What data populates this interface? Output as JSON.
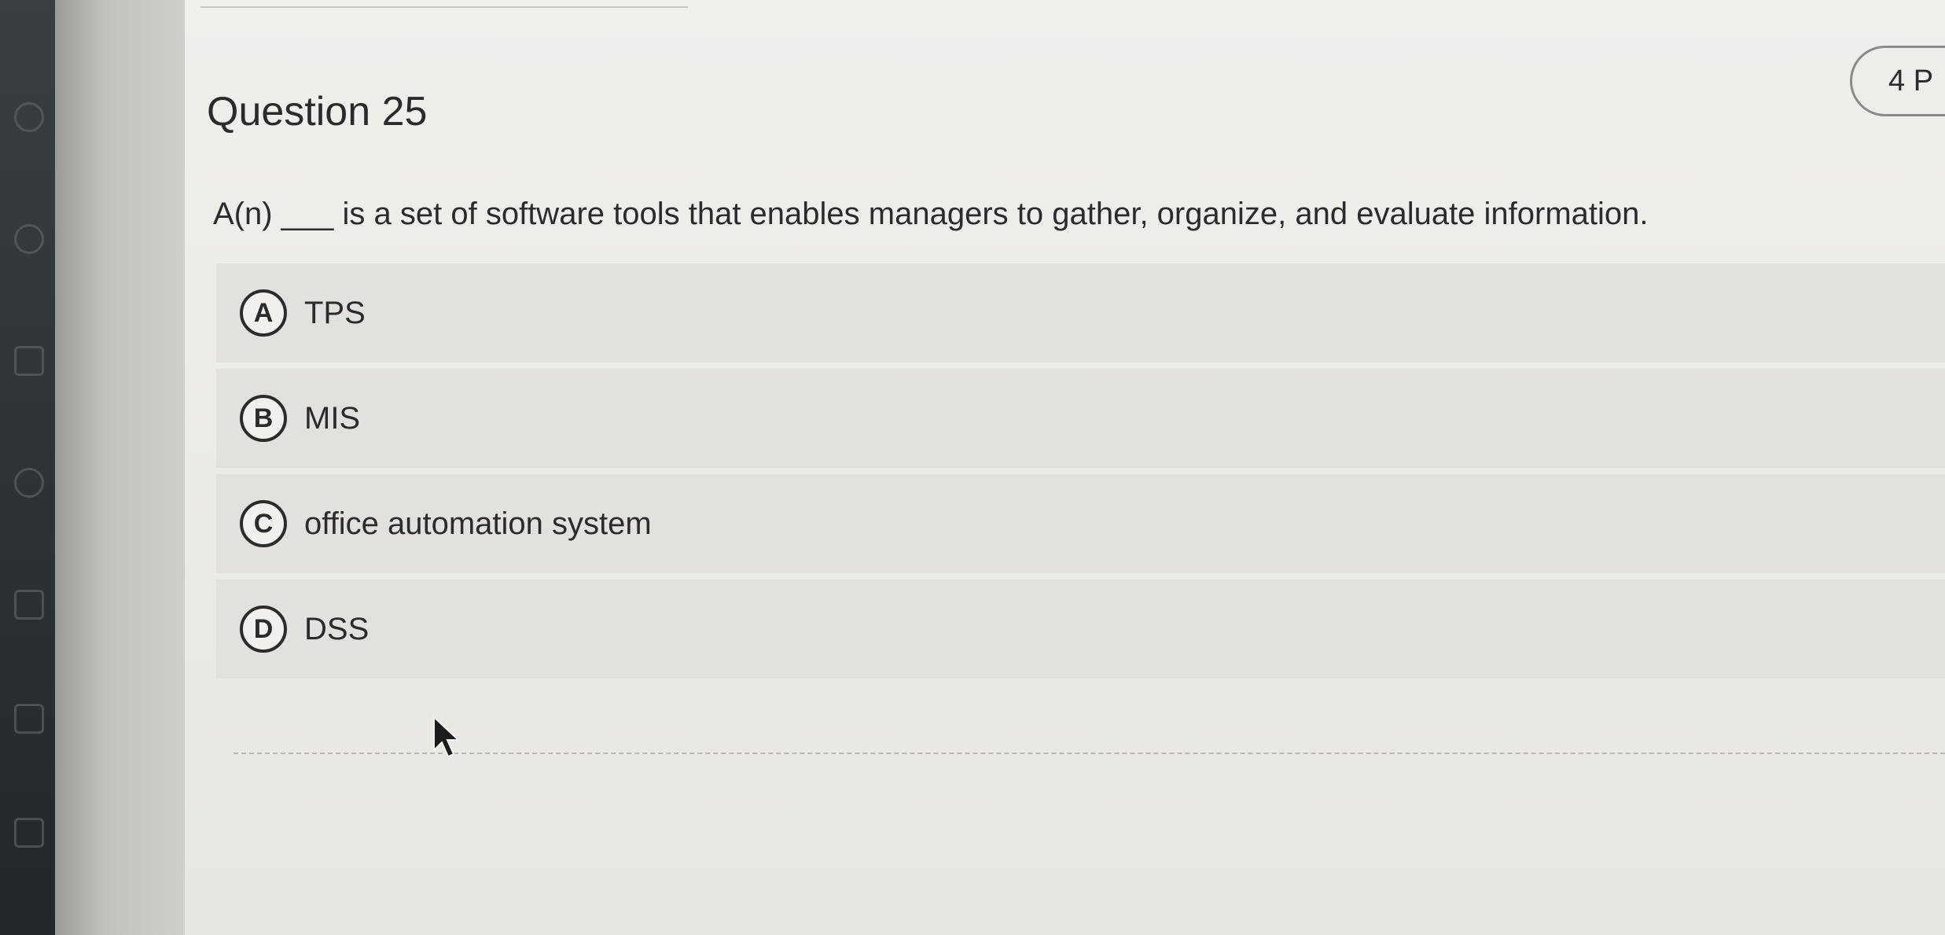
{
  "question": {
    "title": "Question 25",
    "points": "4 P",
    "text": "A(n) ___ is a set of software tools that enables managers to gather, organize, and evaluate information."
  },
  "options": [
    {
      "letter": "A",
      "label": "TPS"
    },
    {
      "letter": "B",
      "label": "MIS"
    },
    {
      "letter": "C",
      "label": "office automation system"
    },
    {
      "letter": "D",
      "label": "DSS"
    }
  ]
}
